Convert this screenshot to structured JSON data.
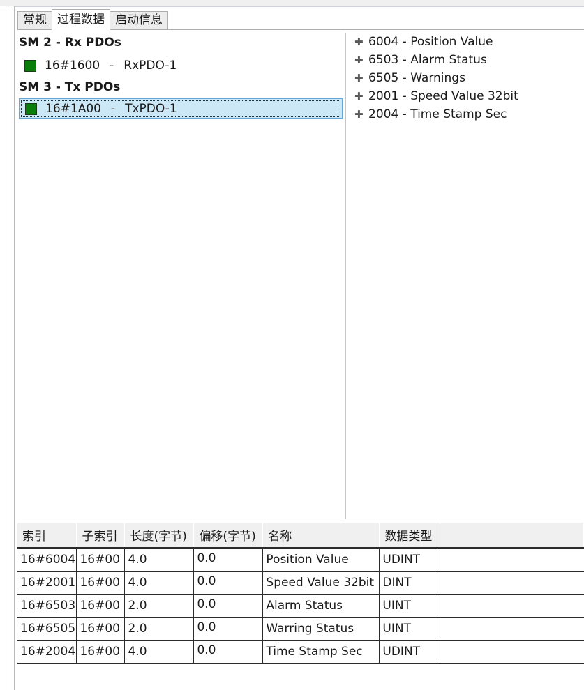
{
  "tabs": [
    {
      "label": "常规",
      "active": false
    },
    {
      "label": "过程数据",
      "active": true
    },
    {
      "label": "启动信息",
      "active": false
    }
  ],
  "left_pane": {
    "rx_header": "SM 2 - Rx PDOs",
    "rx_items": [
      {
        "index": "16#1600",
        "sep": "-",
        "name": "RxPDO-1",
        "checked": true
      }
    ],
    "tx_header": "SM 3 - Tx PDOs",
    "tx_items": [
      {
        "index": "16#1A00",
        "sep": "-",
        "name": "TxPDO-1",
        "checked": true,
        "selected": true
      }
    ]
  },
  "right_pane": {
    "entries": [
      {
        "expand_icon": "plus-icon",
        "label": "6004 - Position Value"
      },
      {
        "expand_icon": "plus-icon",
        "label": "6503 - Alarm Status"
      },
      {
        "expand_icon": "plus-icon",
        "label": "6505 - Warnings"
      },
      {
        "expand_icon": "plus-icon",
        "label": "2001 - Speed Value 32bit"
      },
      {
        "expand_icon": "plus-icon",
        "label": "2004 - Time Stamp Sec"
      }
    ]
  },
  "table": {
    "headers": [
      "索引",
      "子索引",
      "长度(字节)",
      "偏移(字节)",
      "名称",
      "数据类型"
    ],
    "rows": [
      [
        "16#6004",
        "16#00",
        "4.0",
        "0.0",
        "Position Value",
        "UDINT"
      ],
      [
        "16#2001",
        "16#00",
        "4.0",
        "0.0",
        "Speed Value 32bit",
        "DINT"
      ],
      [
        "16#6503",
        "16#00",
        "2.0",
        "0.0",
        "Alarm Status",
        "UINT"
      ],
      [
        "16#6505",
        "16#00",
        "2.0",
        "0.0",
        "Warring Status",
        "UINT"
      ],
      [
        "16#2004",
        "16#00",
        "4.0",
        "0.0",
        "Time Stamp Sec",
        "UDINT"
      ]
    ]
  },
  "colors": {
    "pdo_checked": "#0a7d0a",
    "selection_bg": "#cce8f7",
    "selection_border": "#64a8d8"
  }
}
